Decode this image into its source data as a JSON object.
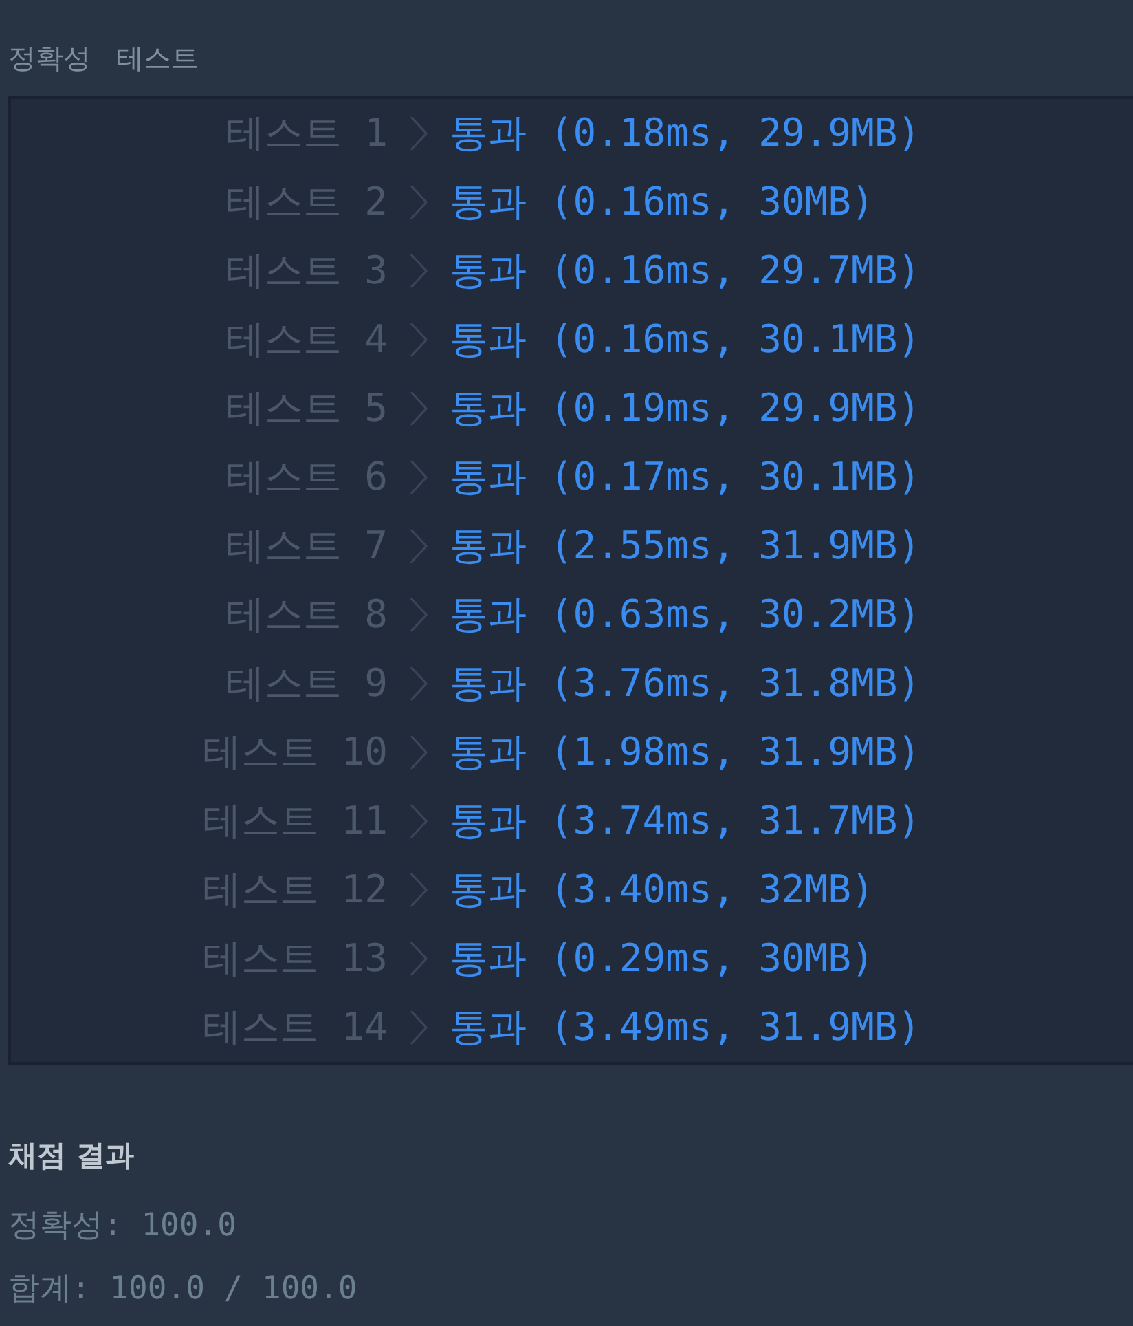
{
  "section": {
    "title": "정확성 테스트"
  },
  "tests": [
    {
      "label": "테스트 1",
      "result": "통과 (0.18ms, 29.9MB)",
      "passed": true
    },
    {
      "label": "테스트 2",
      "result": "통과 (0.16ms, 30MB)",
      "passed": true
    },
    {
      "label": "테스트 3",
      "result": "통과 (0.16ms, 29.7MB)",
      "passed": true
    },
    {
      "label": "테스트 4",
      "result": "통과 (0.16ms, 30.1MB)",
      "passed": true
    },
    {
      "label": "테스트 5",
      "result": "통과 (0.19ms, 29.9MB)",
      "passed": true
    },
    {
      "label": "테스트 6",
      "result": "통과 (0.17ms, 30.1MB)",
      "passed": true
    },
    {
      "label": "테스트 7",
      "result": "통과 (2.55ms, 31.9MB)",
      "passed": true
    },
    {
      "label": "테스트 8",
      "result": "통과 (0.63ms, 30.2MB)",
      "passed": true
    },
    {
      "label": "테스트 9",
      "result": "통과 (3.76ms, 31.8MB)",
      "passed": true
    },
    {
      "label": "테스트 10",
      "result": "통과 (1.98ms, 31.9MB)",
      "passed": true
    },
    {
      "label": "테스트 11",
      "result": "통과 (3.74ms, 31.7MB)",
      "passed": true
    },
    {
      "label": "테스트 12",
      "result": "통과 (3.40ms, 32MB)",
      "passed": true
    },
    {
      "label": "테스트 13",
      "result": "통과 (0.29ms, 30MB)",
      "passed": true
    },
    {
      "label": "테스트 14",
      "result": "통과 (3.49ms, 31.9MB)",
      "passed": true
    }
  ],
  "summary": {
    "title": "채점 결과",
    "lines": [
      "정확성: 100.0",
      "합계: 100.0 / 100.0"
    ]
  }
}
